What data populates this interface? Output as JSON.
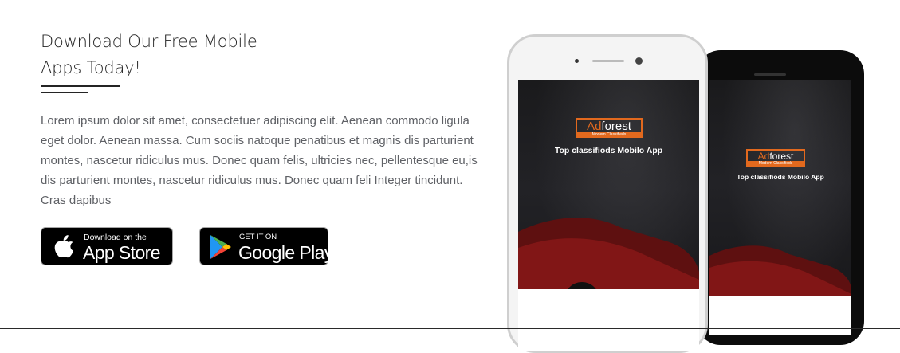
{
  "section": {
    "title_line1": "Download Our Free Mobile",
    "title_line2": "Apps Today!",
    "description": "Lorem ipsum dolor sit amet, consectetuer adipiscing elit. Aenean commodo ligula eget dolor. Aenean massa. Cum sociis natoque penatibus et magnis dis parturient montes, nascetur ridiculus mus. Donec quam felis, ultricies nec, pellentesque eu,is dis parturient montes, nascetur ridiculus mus. Donec quam feli Integer tincidunt. Cras dapibus"
  },
  "badges": {
    "app_store": {
      "small": "Download on the",
      "big": "App Store",
      "icon": "apple-icon"
    },
    "google_play": {
      "small": "GET IT ON",
      "big": "Google Play",
      "icon": "google-play-icon"
    }
  },
  "phones": {
    "logo_prefix": "Ad",
    "logo_suffix": "forest",
    "logo_sub": "Modern Classifieds",
    "tagline": "Top classifiods Mobilo App"
  },
  "colors": {
    "accent": "#e2691e",
    "heading": "#242424",
    "body_text": "#5f6166"
  }
}
